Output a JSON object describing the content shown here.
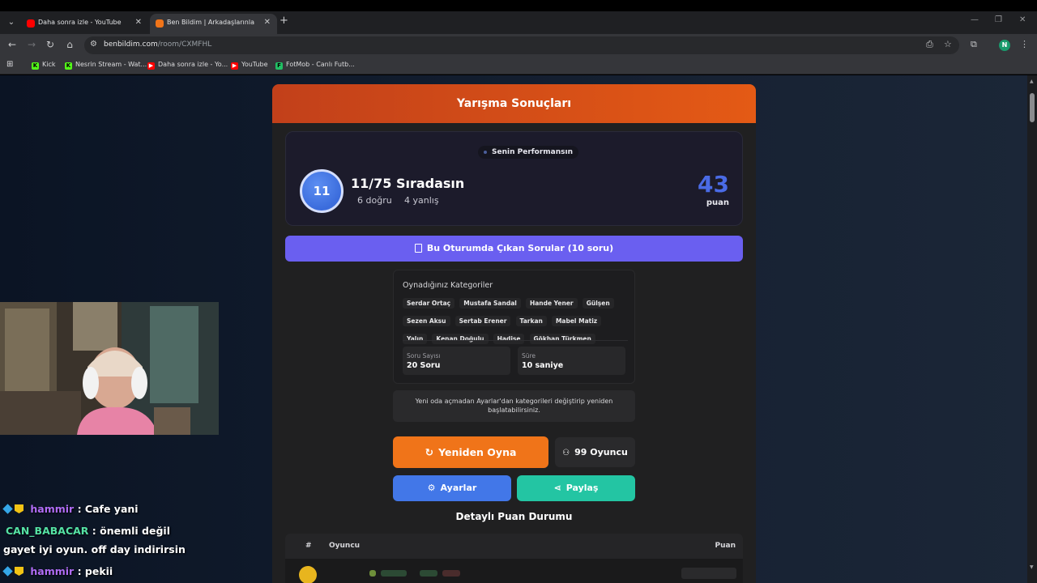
{
  "browser": {
    "tabs": [
      {
        "title": "Daha sonra izle - YouTube",
        "favicon_color": "#ff0000",
        "active": false
      },
      {
        "title": "Ben Bildim | Arkadaşlarınla Onl...",
        "favicon_color": "#f07419",
        "active": true
      }
    ],
    "url": {
      "host": "benbildim.com",
      "path": "/room/CXMFHL"
    },
    "profile_initial": "N",
    "bookmarks": [
      {
        "label": "Kick",
        "icon_letter": "K",
        "color": "#53fc18"
      },
      {
        "label": "Nesrin Stream - Wat...",
        "icon_letter": "K",
        "color": "#53fc18"
      },
      {
        "label": "Daha sonra izle - Yo...",
        "icon_letter": "▶",
        "color": "#ff0000"
      },
      {
        "label": "YouTube",
        "icon_letter": "▶",
        "color": "#ff0000"
      },
      {
        "label": "FotMob - Canlı Futb...",
        "icon_letter": "F",
        "color": "#21c064"
      }
    ]
  },
  "results": {
    "header_title": "Yarışma Sonuçları",
    "performance_pill": "Senin Performansın",
    "rank_number": "11",
    "rank_text": "11/75 Sıradasın",
    "correct_text": "6 doğru",
    "wrong_text": "4 yanlış",
    "score_value": "43",
    "score_label": "puan",
    "questions_button": "Bu Oturumda Çıkan Sorular (10 soru)",
    "categories_title": "Oynadığınız Kategoriler",
    "categories": [
      "Serdar Ortaç",
      "Mustafa Sandal",
      "Hande Yener",
      "Gülşen",
      "Sezen Aksu",
      "Sertab Erener",
      "Tarkan",
      "Mabel Matiz",
      "Yalın",
      "Kenan Doğulu",
      "Hadise",
      "Gökhan Türkmen"
    ],
    "question_count_label": "Soru Sayısı",
    "question_count_value": "20 Soru",
    "duration_label": "Süre",
    "duration_value": "10 saniye",
    "notice_line1": "Yeni oda açmadan Ayarlar'dan kategorileri değiştirip yeniden",
    "notice_line2": "başlatabilirsiniz.",
    "replay_button": "Yeniden Oyna",
    "players_button": "99 Oyuncu",
    "settings_button": "Ayarlar",
    "share_button": "Paylaş",
    "detail_title": "Detaylı Puan Durumu",
    "table_headers": {
      "rank": "#",
      "player": "Oyuncu",
      "score": "Puan"
    }
  },
  "chat": [
    {
      "user": "hammir",
      "message": ": Cafe yani",
      "color": "#b06cf5",
      "badges": true
    },
    {
      "user": "CAN_BABACAR",
      "message": ": önemli değil",
      "color": "#55e2a4",
      "badges": false
    },
    {
      "user": "",
      "message": "gayet iyi oyun. off day indirirsin",
      "color": "#ffffff",
      "badges": false
    },
    {
      "user": "hammir",
      "message": ": pekii",
      "color": "#b06cf5",
      "badges": true
    }
  ]
}
